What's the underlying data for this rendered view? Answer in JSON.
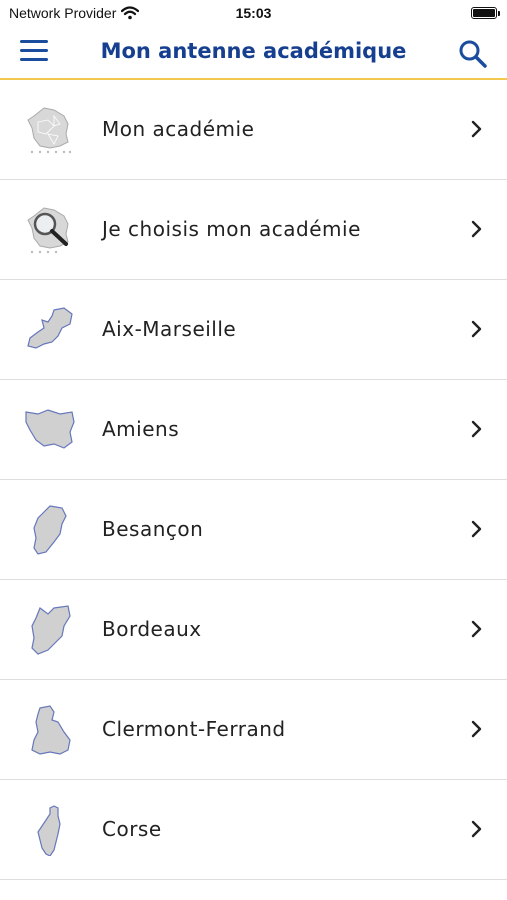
{
  "status_bar": {
    "carrier": "Network Provider",
    "time": "15:03",
    "wifi_icon": "wifi-icon",
    "battery_icon": "battery-icon"
  },
  "nav": {
    "title": "Mon antenne académique",
    "menu_icon": "hamburger-menu-icon",
    "search_icon": "search-icon"
  },
  "colors": {
    "title_blue": "#163f8f",
    "accent_yellow": "#f2c94c",
    "map_fill": "#d0d0d0",
    "map_outline": "#6677bb"
  },
  "list": {
    "items": [
      {
        "label": "Mon académie",
        "icon": "france-map-icon"
      },
      {
        "label": "Je choisis mon académie",
        "icon": "france-map-magnifier-icon"
      },
      {
        "label": "Aix-Marseille",
        "icon": "aix-marseille-map-icon"
      },
      {
        "label": "Amiens",
        "icon": "amiens-map-icon"
      },
      {
        "label": "Besançon",
        "icon": "besancon-map-icon"
      },
      {
        "label": "Bordeaux",
        "icon": "bordeaux-map-icon"
      },
      {
        "label": "Clermont-Ferrand",
        "icon": "clermont-ferrand-map-icon"
      },
      {
        "label": "Corse",
        "icon": "corse-map-icon"
      }
    ]
  }
}
